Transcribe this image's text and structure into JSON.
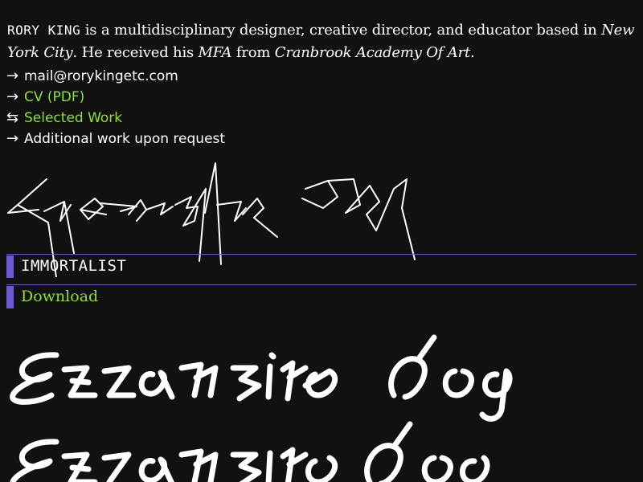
{
  "intro": {
    "name": "RORY KING",
    "text_1": " is a multidisciplinary designer, creative director, and educator based in ",
    "city": "New York City",
    "text_2": ". He received his ",
    "degree": "MFA",
    "text_3": " from ",
    "school": "Cranbrook Academy Of Art",
    "text_4": "."
  },
  "links": [
    {
      "arrow": "→",
      "label": "mail@rorykingetc.com"
    },
    {
      "arrow": "→",
      "label": "CV (PDF)"
    },
    {
      "arrow": "⇆",
      "label": "Selected Work"
    },
    {
      "arrow": "→",
      "label": "Additional work upon request"
    }
  ],
  "font": {
    "name": "IMMORTALIST",
    "download_label": "Download",
    "specimen_text": "Expensive Dog"
  },
  "colors": {
    "background": "#111111",
    "accent_green": "#8ee12b",
    "accent_purple": "#6a5acd"
  }
}
